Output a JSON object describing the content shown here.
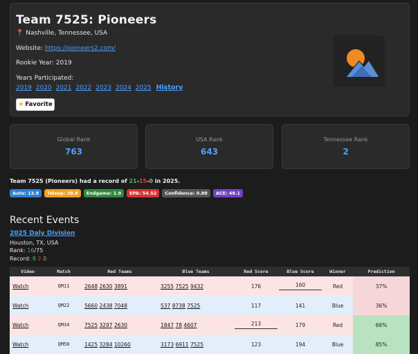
{
  "team": {
    "title": "Team 7525: Pioneers",
    "location": "Nashville, Tennessee, USA",
    "website_label": "Website:",
    "website_url": "https://pioneers2.com/",
    "rookie_year": "Rookie Year: 2019",
    "years_label": "Years Participated:",
    "years": [
      "2019",
      "2020",
      "2021",
      "2022",
      "2023",
      "2024",
      "2025"
    ],
    "history_link": "History",
    "favorite_button": "Favorite",
    "logo_icon": "mountain-sun-logo-icon"
  },
  "ranks": [
    {
      "label": "Global Rank",
      "value": "763"
    },
    {
      "label": "USA Rank",
      "value": "643"
    },
    {
      "label": "Tennessee Rank",
      "value": "2"
    }
  ],
  "record": {
    "prefix": "Team 7525 (Pioneers) had a record of ",
    "wins": "21",
    "losses": "15",
    "ties": "0",
    "suffix": " in 2025."
  },
  "badges": [
    {
      "label": "Auto: 13.8",
      "color": "#2f7fd3"
    },
    {
      "label": "Teleop: 38.8",
      "color": "#f0a020"
    },
    {
      "label": "Endgame: 1.9",
      "color": "#2e8b3e"
    },
    {
      "label": "EPA: 54.52",
      "color": "#d63333"
    },
    {
      "label": "Confidence: 0.88",
      "color": "#555555"
    },
    {
      "label": "ACE: 48.1",
      "color": "#6f42c1"
    }
  ],
  "events": {
    "heading": "Recent Events",
    "event_name": "2025 Daly Division",
    "event_location": "Houston, TX, USA",
    "rank_label": "Rank: ",
    "rank_value": "16",
    "rank_total": "/75",
    "record_label": "Record: ",
    "record_w": "8",
    "record_l": "2",
    "record_t": "0"
  },
  "table": {
    "headers": [
      "Video",
      "Match",
      "Red Teams",
      "Blue Teams",
      "Red Score",
      "Blue Score",
      "Winner",
      "Prediction"
    ],
    "rows": [
      {
        "video": "Watch",
        "match": "QM11",
        "red": [
          "2648",
          "2630",
          "3891"
        ],
        "blue": [
          "3255",
          "7525",
          "9432"
        ],
        "red_score": "176",
        "blue_score": "160",
        "winner": "Red",
        "prediction": "37%",
        "row_color": "red"
      },
      {
        "video": "Watch",
        "match": "QM22",
        "red": [
          "5660",
          "2438",
          "7048"
        ],
        "blue": [
          "537",
          "8738",
          "7525"
        ],
        "red_score": "117",
        "blue_score": "141",
        "winner": "Blue",
        "prediction": "36%",
        "row_color": "blue"
      },
      {
        "video": "Watch",
        "match": "QM34",
        "red": [
          "7525",
          "3297",
          "2630"
        ],
        "blue": [
          "1847",
          "78",
          "4607"
        ],
        "red_score": "213",
        "blue_score": "179",
        "winner": "Red",
        "prediction": "66%",
        "row_color": "red"
      },
      {
        "video": "Watch",
        "match": "QM50",
        "red": [
          "1425",
          "3284",
          "10260"
        ],
        "blue": [
          "3173",
          "6911",
          "7525"
        ],
        "red_score": "123",
        "blue_score": "194",
        "winner": "Blue",
        "prediction": "85%",
        "row_color": "blue"
      }
    ]
  }
}
